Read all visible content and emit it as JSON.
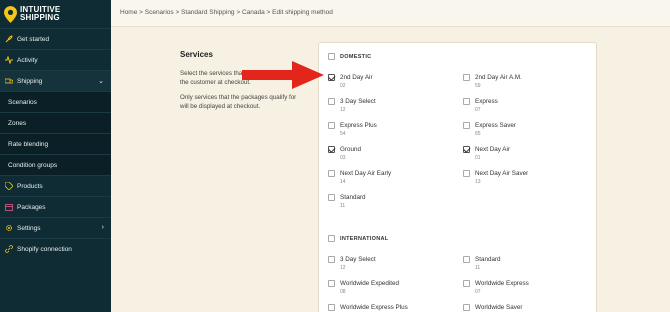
{
  "brand": {
    "line1": "INTUITIVE",
    "line2": "SHIPPING"
  },
  "sidebar": {
    "items": [
      {
        "label": "Get started",
        "icon": "rocket-icon"
      },
      {
        "label": "Activity",
        "icon": "activity-icon"
      },
      {
        "label": "Shipping",
        "icon": "truck-icon",
        "expanded": true
      },
      {
        "label": "Scenarios"
      },
      {
        "label": "Zones"
      },
      {
        "label": "Rate blending"
      },
      {
        "label": "Condition groups"
      },
      {
        "label": "Products",
        "icon": "tag-icon"
      },
      {
        "label": "Packages",
        "icon": "package-icon"
      },
      {
        "label": "Settings",
        "icon": "gear-icon"
      },
      {
        "label": "Shopify connection",
        "icon": "link-icon"
      }
    ]
  },
  "breadcrumb": "Home > Scenarios > Standard Shipping > Canada > Edit shipping method",
  "services": {
    "title": "Services",
    "desc1": "Select the services that will be available to the customer at checkout.",
    "desc2": "Only services that the packages qualify for will be displayed at checkout."
  },
  "domestic": {
    "heading": "DOMESTIC",
    "options": [
      {
        "name": "2nd Day Air",
        "code": "02",
        "checked": true
      },
      {
        "name": "2nd Day Air A.M.",
        "code": "59",
        "checked": false
      },
      {
        "name": "3 Day Select",
        "code": "12",
        "checked": false
      },
      {
        "name": "Express",
        "code": "07",
        "checked": false
      },
      {
        "name": "Express Plus",
        "code": "54",
        "checked": false
      },
      {
        "name": "Express Saver",
        "code": "65",
        "checked": false
      },
      {
        "name": "Ground",
        "code": "03",
        "checked": true
      },
      {
        "name": "Next Day Air",
        "code": "01",
        "checked": true
      },
      {
        "name": "Next Day Air Early",
        "code": "14",
        "checked": false
      },
      {
        "name": "Next Day Air Saver",
        "code": "13",
        "checked": false
      },
      {
        "name": "Standard",
        "code": "11",
        "checked": false
      }
    ]
  },
  "international": {
    "heading": "INTERNATIONAL",
    "options": [
      {
        "name": "3 Day Select",
        "code": "12",
        "checked": false
      },
      {
        "name": "Standard",
        "code": "11",
        "checked": false
      },
      {
        "name": "Worldwide Expedited",
        "code": "08",
        "checked": false
      },
      {
        "name": "Worldwide Express",
        "code": "07",
        "checked": false
      },
      {
        "name": "Worldwide Express Plus",
        "code": "",
        "checked": false
      },
      {
        "name": "Worldwide Saver",
        "code": "",
        "checked": false
      }
    ]
  },
  "colors": {
    "sidebar": "#0f2b33",
    "accent": "#f5c518",
    "arrow": "#e3261b",
    "background": "#f7f1e3"
  }
}
